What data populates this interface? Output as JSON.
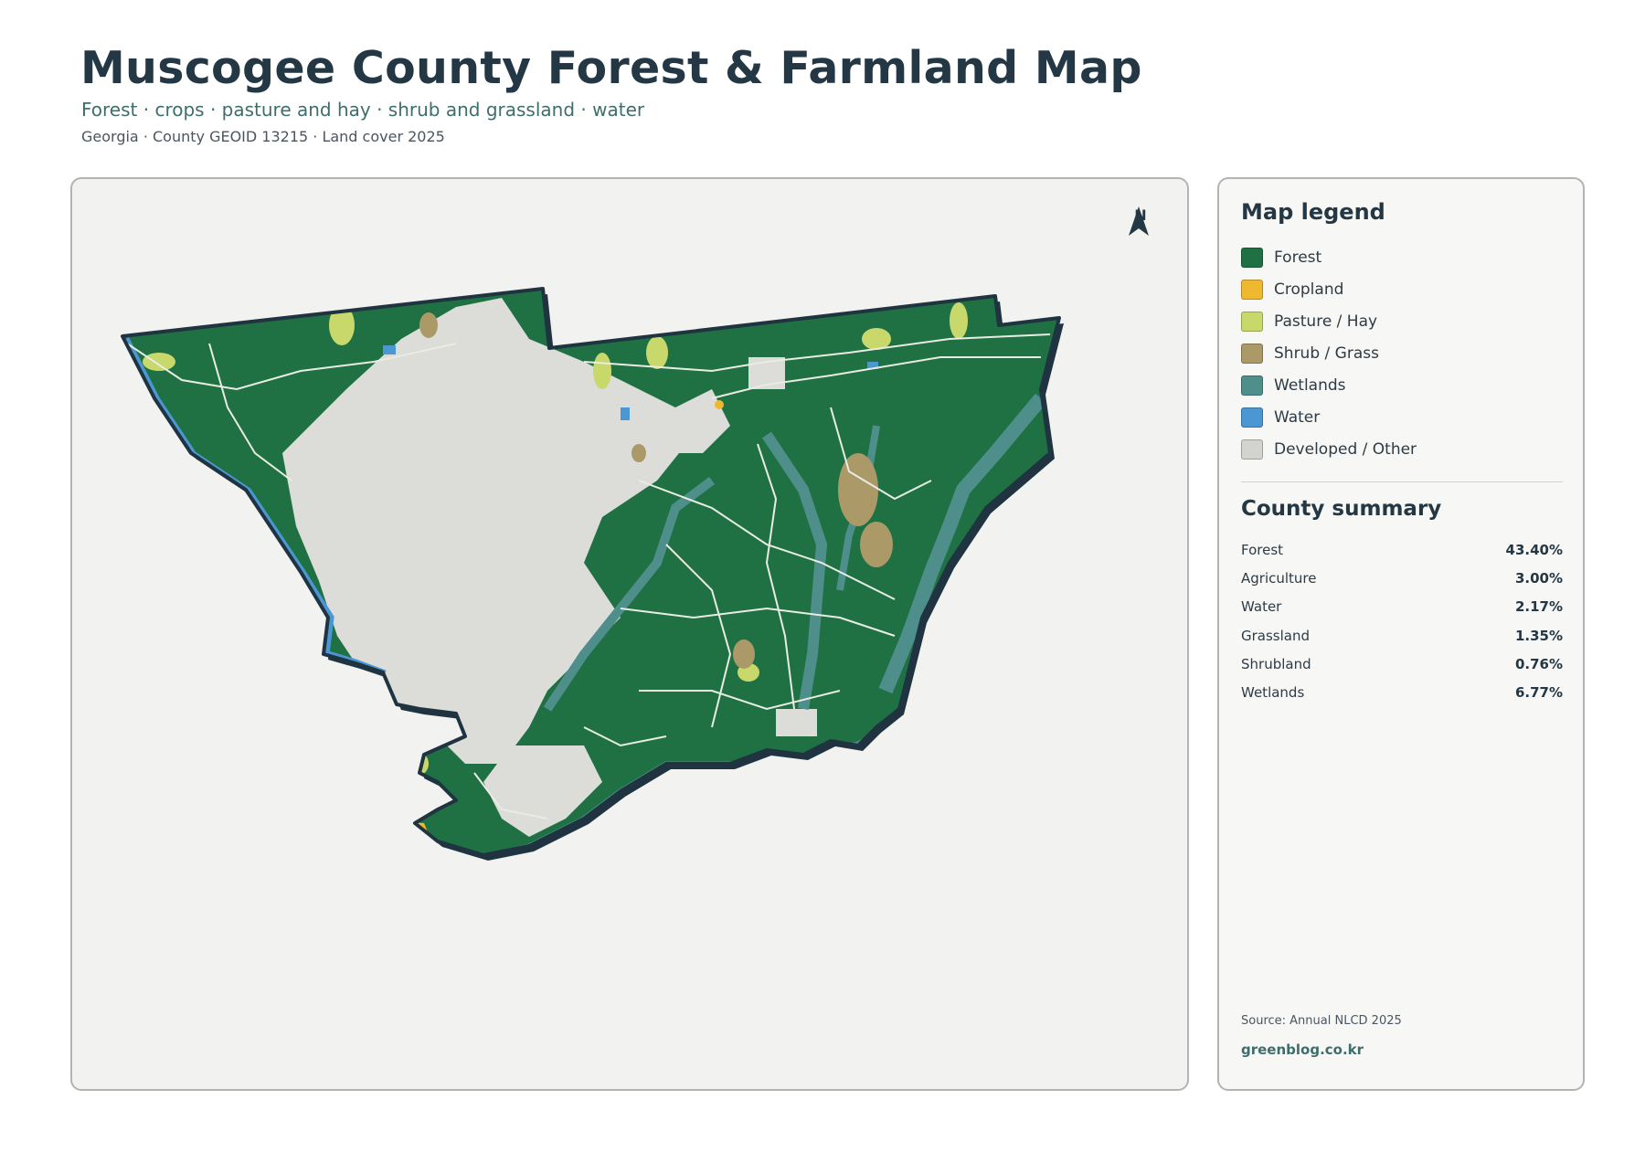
{
  "header": {
    "title": "Muscogee County Forest & Farmland Map",
    "subtitle": "Forest · crops · pasture and hay · shrub and grassland · water",
    "meta": "Georgia · County GEOID 13215 · Land cover 2025"
  },
  "map": {
    "north_label": "N",
    "colors": {
      "forest": "#1f7144",
      "cropland": "#efb92f",
      "pasture": "#c9d86b",
      "shrub": "#ab9a68",
      "wetlands": "#4e8f8c",
      "water": "#4a97d4",
      "developed": "#dcdcd9",
      "boundary": "#1f3440",
      "roads": "#e9ece3"
    }
  },
  "legend": {
    "title": "Map legend",
    "items": [
      {
        "label": "Forest",
        "color": "#1f7144"
      },
      {
        "label": "Cropland",
        "color": "#efb92f"
      },
      {
        "label": "Pasture / Hay",
        "color": "#c9d86b"
      },
      {
        "label": "Shrub / Grass",
        "color": "#ab9a68"
      },
      {
        "label": "Wetlands",
        "color": "#4e8f8c"
      },
      {
        "label": "Water",
        "color": "#4a97d4"
      },
      {
        "label": "Developed / Other",
        "color": "#d3d3d0"
      }
    ]
  },
  "summary": {
    "title": "County summary",
    "rows": [
      {
        "name": "Forest",
        "value": "43.40%"
      },
      {
        "name": "Agriculture",
        "value": "3.00%"
      },
      {
        "name": "Water",
        "value": "2.17%"
      },
      {
        "name": "Grassland",
        "value": "1.35%"
      },
      {
        "name": "Shrubland",
        "value": "0.76%"
      },
      {
        "name": "Wetlands",
        "value": "6.77%"
      }
    ]
  },
  "footer": {
    "source": "Source: Annual NLCD 2025",
    "credit": "greenblog.co.kr"
  }
}
